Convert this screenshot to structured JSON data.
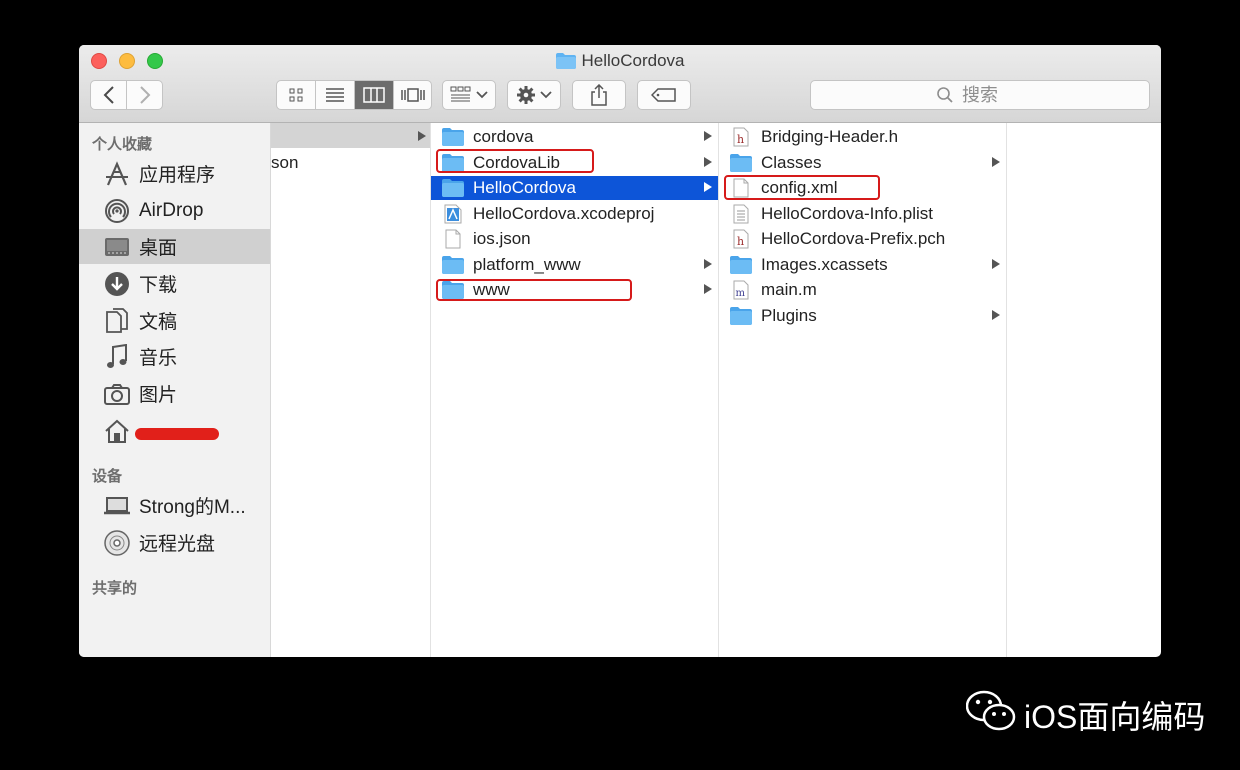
{
  "window": {
    "title": "HelloCordova"
  },
  "toolbar": {
    "back_icon": "chevron-left-icon",
    "forward_icon": "chevron-right-icon",
    "view_modes": [
      "icon-view-icon",
      "list-view-icon",
      "column-view-icon",
      "cover-flow-icon"
    ],
    "active_view_mode": "column-view-icon",
    "arrange_icon": "arrange-grid-icon",
    "action_icon": "gear-icon",
    "share_icon": "share-icon",
    "tag_icon": "tag-icon",
    "search_placeholder": "搜索"
  },
  "sidebar": {
    "favorites_header": "个人收藏",
    "favorites": [
      {
        "label": "应用程序",
        "icon": "applications-icon"
      },
      {
        "label": "AirDrop",
        "icon": "airdrop-icon"
      },
      {
        "label": "桌面",
        "icon": "desktop-icon",
        "selected": true
      },
      {
        "label": "下载",
        "icon": "downloads-icon"
      },
      {
        "label": "文稿",
        "icon": "documents-icon"
      },
      {
        "label": "音乐",
        "icon": "music-icon"
      },
      {
        "label": "图片",
        "icon": "pictures-icon"
      },
      {
        "label": "",
        "icon": "home-icon",
        "redacted": true
      }
    ],
    "devices_header": "设备",
    "devices": [
      {
        "label": "Strong的M...",
        "icon": "laptop-icon"
      },
      {
        "label": "远程光盘",
        "icon": "disc-icon"
      }
    ],
    "shared_header": "共享的"
  },
  "columns": {
    "col1": {
      "partial_text": "son"
    },
    "col2": [
      {
        "name": "cordova",
        "type": "folder",
        "has_children": true
      },
      {
        "name": "CordovaLib",
        "type": "folder",
        "has_children": true,
        "highlighted": true
      },
      {
        "name": "HelloCordova",
        "type": "folder",
        "has_children": true,
        "selected": true
      },
      {
        "name": "HelloCordova.xcodeproj",
        "type": "xcodeproj",
        "has_children": false
      },
      {
        "name": "ios.json",
        "type": "file",
        "has_children": false
      },
      {
        "name": "platform_www",
        "type": "folder",
        "has_children": true
      },
      {
        "name": "www",
        "type": "folder",
        "has_children": true,
        "highlighted": true
      }
    ],
    "col3": [
      {
        "name": "Bridging-Header.h",
        "type": "header",
        "has_children": false
      },
      {
        "name": "Classes",
        "type": "folder",
        "has_children": true
      },
      {
        "name": "config.xml",
        "type": "file",
        "has_children": false,
        "highlighted": true
      },
      {
        "name": "HelloCordova-Info.plist",
        "type": "plist",
        "has_children": false
      },
      {
        "name": "HelloCordova-Prefix.pch",
        "type": "header",
        "has_children": false
      },
      {
        "name": "Images.xcassets",
        "type": "folder",
        "has_children": true
      },
      {
        "name": "main.m",
        "type": "source",
        "has_children": false
      },
      {
        "name": "Plugins",
        "type": "folder",
        "has_children": true
      }
    ]
  },
  "watermark": {
    "text": "iOS面向编码",
    "icon": "wechat-icon"
  },
  "colors": {
    "selection": "#0d55d8",
    "highlight_box": "#d61a1a",
    "folder": "#5fb3f2"
  }
}
